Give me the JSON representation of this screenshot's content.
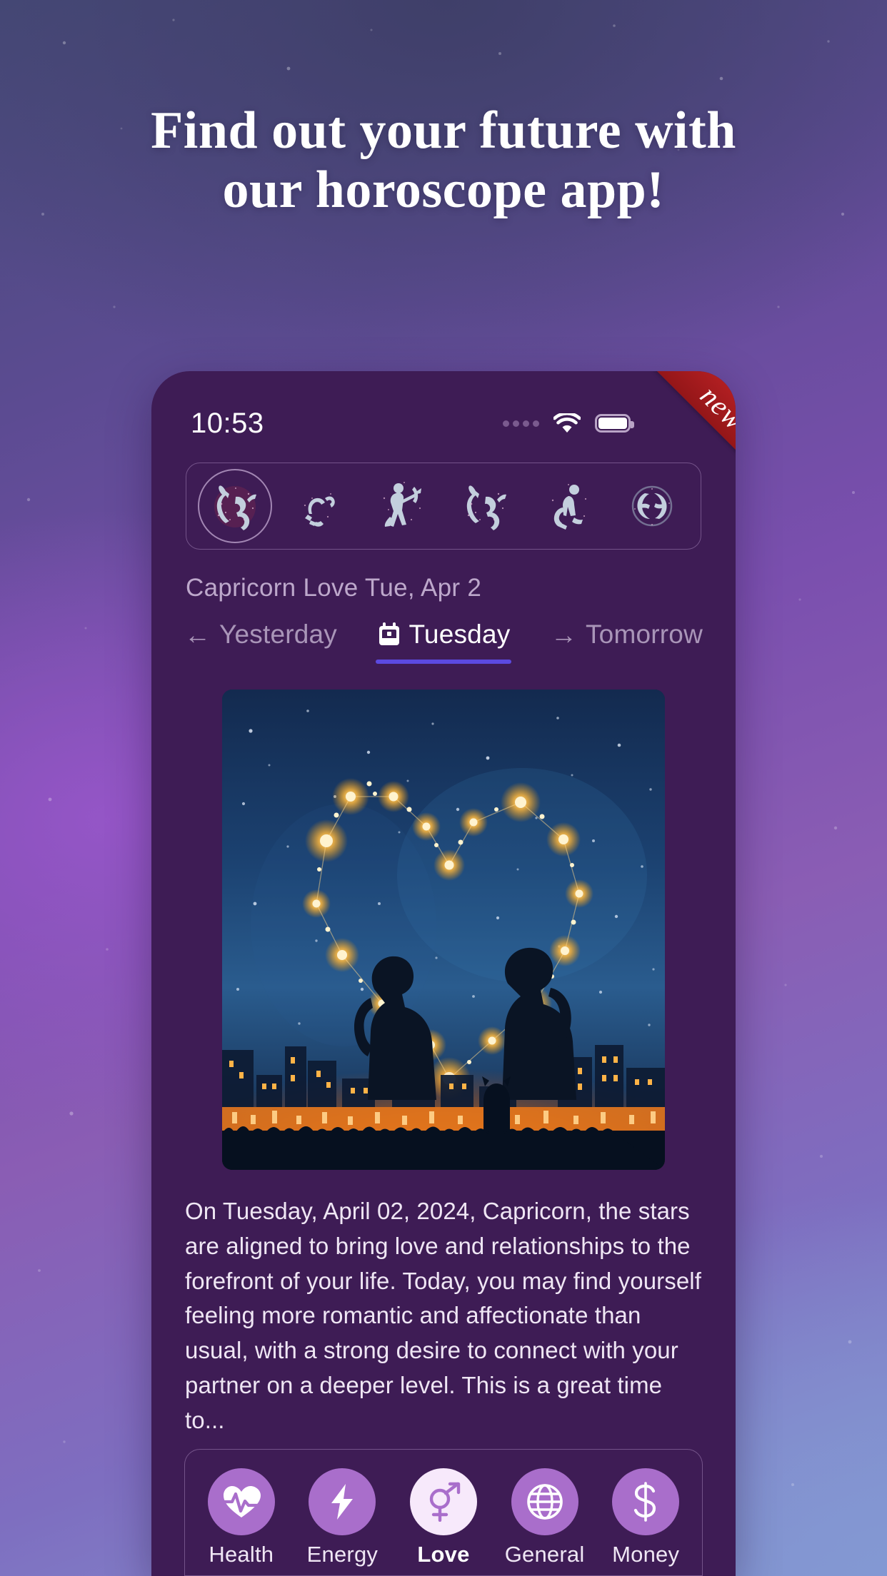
{
  "page": {
    "headline_line1": "Find out your future with",
    "headline_line2": "our horoscope app!",
    "ribbon_label": "new",
    "accent_color": "#5b4ae0",
    "phone_bg": "#3e1c55",
    "ribbon_color": "#a01b1b"
  },
  "statusbar": {
    "time": "10:53",
    "signal_icon": "signal-dots-icon",
    "wifi_icon": "wifi-icon",
    "battery_icon": "battery-full-icon"
  },
  "zodiac": {
    "signs": [
      {
        "name": "Capricorn",
        "icon": "capricorn-icon",
        "selected": true
      },
      {
        "name": "Scorpio",
        "icon": "scorpio-icon",
        "selected": false
      },
      {
        "name": "Sagittarius",
        "icon": "sagittarius-icon",
        "selected": false
      },
      {
        "name": "Capricorn",
        "icon": "capricorn-icon",
        "selected": false
      },
      {
        "name": "Aquarius",
        "icon": "aquarius-icon",
        "selected": false
      },
      {
        "name": "Pisces",
        "icon": "pisces-icon",
        "selected": false
      }
    ]
  },
  "header": {
    "subtitle": "Capricorn Love Tue, Apr 2"
  },
  "daytabs": [
    {
      "label": "Yesterday",
      "icon": "arrow-left-icon",
      "glyph": "←",
      "active": false
    },
    {
      "label": "Tuesday",
      "icon": "calendar-icon",
      "glyph": "",
      "active": true
    },
    {
      "label": "Tomorrow",
      "icon": "arrow-right-icon",
      "glyph": "→",
      "active": false
    }
  ],
  "hero": {
    "alt": "Two silhouetted friends watching a heart-shaped star constellation over a glowing city skyline"
  },
  "main": {
    "reading": "On Tuesday, April 02, 2024, Capricorn, the stars are aligned to bring love and relationships to the forefront of your life. Today, you may find yourself feeling more romantic and affectionate than usual, with a strong desire to connect with your partner on a deeper level. This is a great time to..."
  },
  "bottomnav": [
    {
      "label": "Health",
      "icon": "heart-pulse-icon",
      "active": false
    },
    {
      "label": "Energy",
      "icon": "lightning-bolt-icon",
      "active": false
    },
    {
      "label": "Love",
      "icon": "mars-venus-icon",
      "active": true
    },
    {
      "label": "General",
      "icon": "globe-icon",
      "active": false
    },
    {
      "label": "Money",
      "icon": "dollar-icon",
      "active": false
    }
  ]
}
